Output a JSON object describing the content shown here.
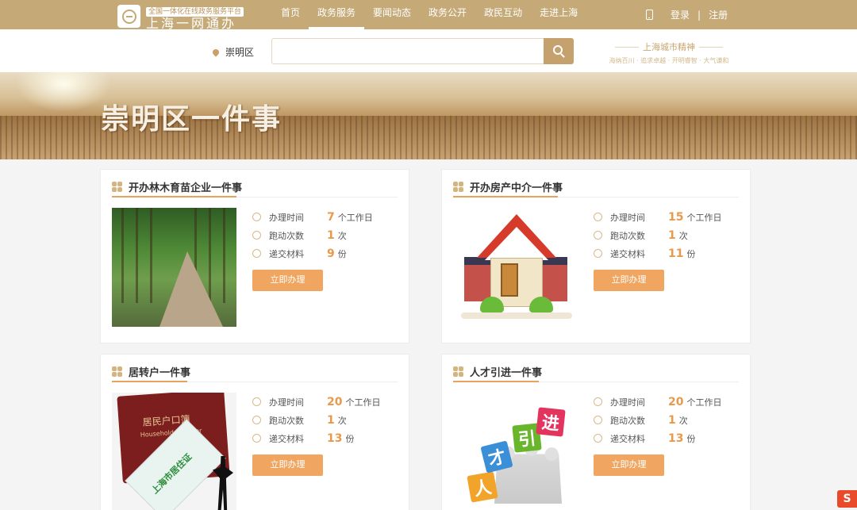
{
  "header": {
    "logo_sub": "全国一体化在线政务服务平台",
    "logo_main": "上海一网通办",
    "nav": [
      "首页",
      "政务服务",
      "要闻动态",
      "政务公开",
      "政民互动",
      "走进上海"
    ],
    "active_nav": "政务服务",
    "login": "登录",
    "separator": "|",
    "register": "注册"
  },
  "search": {
    "location": "崇明区",
    "placeholder": "",
    "spirit_title": "上海城市精神",
    "spirit_sub": "海纳百川 · 追求卓越 · 开明睿智 · 大气谦和"
  },
  "banner": {
    "title": "崇明区一件事"
  },
  "cards": [
    {
      "title": "开办林木育苗企业一件事",
      "time_label": "办理时间",
      "time_value": "7",
      "time_unit": "个工作日",
      "trips_label": "跑动次数",
      "trips_value": "1",
      "trips_unit": "次",
      "materials_label": "递交材料",
      "materials_value": "9",
      "materials_unit": "份",
      "button": "立即办理",
      "image": "forest-path"
    },
    {
      "title": "开办房产中介一件事",
      "time_label": "办理时间",
      "time_value": "15",
      "time_unit": "个工作日",
      "trips_label": "跑动次数",
      "trips_value": "1",
      "trips_unit": "次",
      "materials_label": "递交材料",
      "materials_value": "11",
      "materials_unit": "份",
      "button": "立即办理",
      "image": "house-illustration"
    },
    {
      "title": "居转户一件事",
      "time_label": "办理时间",
      "time_value": "20",
      "time_unit": "个工作日",
      "trips_label": "跑动次数",
      "trips_value": "1",
      "trips_unit": "次",
      "materials_label": "递交材料",
      "materials_value": "13",
      "materials_unit": "份",
      "button": "立即办理",
      "image": "household-register-book",
      "book_cn": "居民户口簿",
      "book_en": "Household Register",
      "card_text": "上海市居住证"
    },
    {
      "title": "人才引进一件事",
      "time_label": "办理时间",
      "time_value": "20",
      "time_unit": "个工作日",
      "trips_label": "跑动次数",
      "trips_value": "1",
      "trips_unit": "次",
      "materials_label": "递交材料",
      "materials_value": "13",
      "materials_unit": "份",
      "button": "立即办理",
      "image": "talent-blocks",
      "blocks": [
        "人",
        "才",
        "引",
        "进"
      ]
    }
  ],
  "colors": {
    "brand": "#c5aa78",
    "accent": "#f0a660",
    "value": "#e79a4c"
  },
  "overlay_badge": "S"
}
